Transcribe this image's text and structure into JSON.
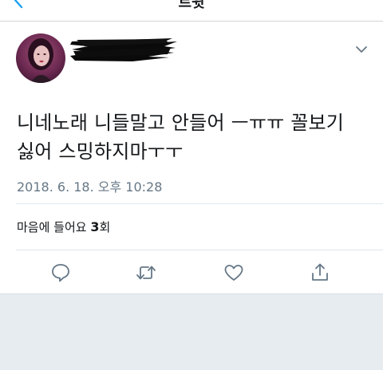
{
  "header": {
    "title": "트윗"
  },
  "author": {
    "name_redacted": "[redacted]"
  },
  "tweet": {
    "text_line1": "니네노래 니들말고 안들어 ㅡㅠㅠ 꼴보기",
    "text_line2": "싫어 스밍하지마ㅜㅜ",
    "timestamp": "2018. 6. 18. 오후 10:28"
  },
  "stats": {
    "likes_label": "마음에 들어요",
    "likes_count": "3",
    "likes_suffix": "회"
  },
  "actions": {
    "reply_icon": "reply-icon",
    "retweet_icon": "retweet-icon",
    "like_icon": "heart-icon",
    "share_icon": "share-icon"
  },
  "colors": {
    "accent": "#1da1f2",
    "text": "#14171a",
    "secondary_text": "#657786",
    "icon": "#657786",
    "background_bottom": "#e6ecf0"
  }
}
